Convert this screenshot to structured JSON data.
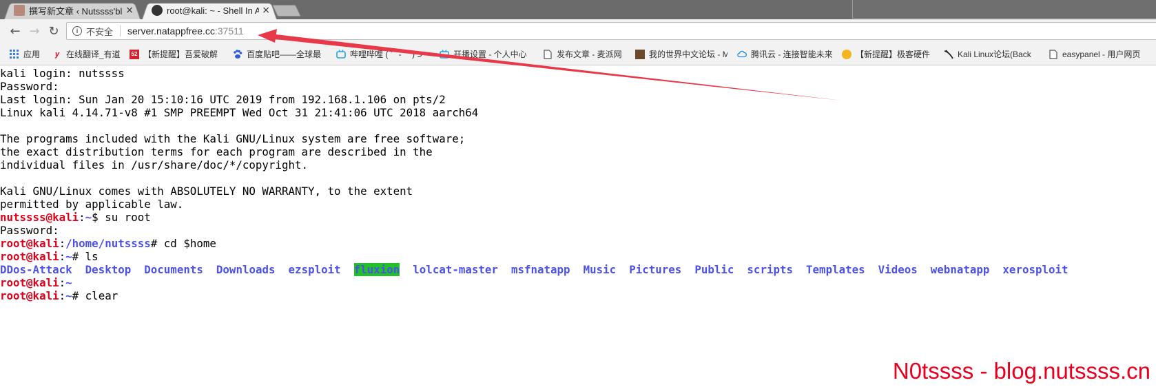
{
  "tabs": [
    {
      "title": "撰写新文章 ‹ Nutssss'blo",
      "close": "×",
      "active": false
    },
    {
      "title": "root@kali: ~ - Shell In A",
      "close": "×",
      "active": true
    }
  ],
  "toolbar": {
    "back_icon": "←",
    "forward_icon": "→",
    "reload_icon": "↻",
    "insecure_label": "不安全",
    "url_host": "server.natappfree.cc",
    "url_port": ":37511"
  },
  "bookmarks": [
    {
      "label": "应用",
      "icon": "apps-grid-icon"
    },
    {
      "label": "在线翻译_有道",
      "icon": "youdao-icon"
    },
    {
      "label": "【新提醒】吾爱破解",
      "icon": "52pojie-icon"
    },
    {
      "label": "百度贴吧——全球最",
      "icon": "baidu-icon"
    },
    {
      "label": "哔哩哔哩 ( ゜- ゜)つ",
      "icon": "bilibili-icon"
    },
    {
      "label": "开播设置 - 个人中心",
      "icon": "tv-icon"
    },
    {
      "label": "发布文章 - 麦派网",
      "icon": "page-icon"
    },
    {
      "label": "我的世界中文论坛 - M",
      "icon": "minecraft-icon"
    },
    {
      "label": "腾讯云 - 连接智能未来",
      "icon": "cloud-icon"
    },
    {
      "label": "【新提醒】极客硬件",
      "icon": "geek-icon"
    },
    {
      "label": "Kali Linux论坛(Back",
      "icon": "kali-icon"
    },
    {
      "label": "easypanel - 用户网页",
      "icon": "page-icon"
    }
  ],
  "terminal": {
    "lines": [
      "kali login: nutssss",
      "Password:",
      "Last login: Sun Jan 20 15:10:16 UTC 2019 from 192.168.1.106 on pts/2",
      "Linux kali 4.14.71-v8 #1 SMP PREEMPT Wed Oct 31 21:41:06 UTC 2018 aarch64",
      "",
      "The programs included with the Kali GNU/Linux system are free software;",
      "the exact distribution terms for each program are described in the",
      "individual files in /usr/share/doc/*/copyright.",
      "",
      "Kali GNU/Linux comes with ABSOLUTELY NO WARRANTY, to the extent",
      "permitted by applicable law."
    ],
    "prompt1": {
      "user": "nutssss@kali",
      "sep": ":",
      "path": "~",
      "sym": "$ ",
      "cmd": "su root"
    },
    "password": "Password:",
    "prompt2": {
      "user": "root@kali",
      "sep": ":",
      "path": "/home/nutssss",
      "sym": "# ",
      "cmd": "cd $home"
    },
    "prompt3": {
      "user": "root@kali",
      "sep": ":",
      "path": "~",
      "sym": "# ",
      "cmd": "ls"
    },
    "ls_items": [
      "DDos-Attack",
      "Desktop",
      "Documents",
      "Downloads",
      "ezsploit",
      "fluxion",
      "lolcat-master",
      "msfnatapp",
      "Music",
      "Pictures",
      "Public",
      "scripts",
      "Templates",
      "Videos",
      "webnatapp",
      "xerosploit"
    ],
    "ls_highlight": "fluxion",
    "prompt4": {
      "user": "root@kali",
      "sep": ":",
      "path": "~",
      "sym": "",
      "cmd": ""
    },
    "prompt5": {
      "user": "root@kali",
      "sep": ":",
      "path": "~",
      "sym": "# ",
      "cmd": "clear"
    }
  },
  "watermark": "N0tssss - blog.nutssss.cn",
  "colors": {
    "prompt_user": "#e0001a",
    "prompt_path": "#4c52e8",
    "arrow": "#e8394a"
  }
}
